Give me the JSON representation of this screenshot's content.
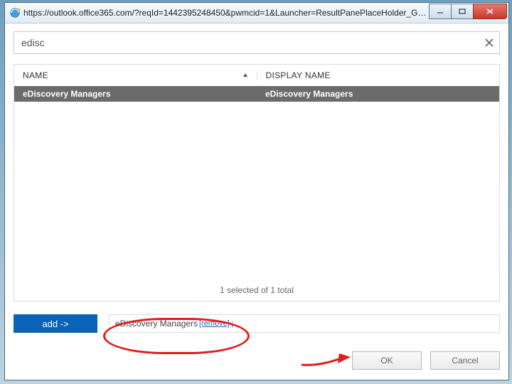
{
  "titlebar": {
    "url": "https://outlook.office365.com/?reqId=1442395248450&pwmcid=1&Launcher=ResultPanePlaceHolder_Gro..."
  },
  "search": {
    "value": "edisc"
  },
  "columns": {
    "name_header": "NAME",
    "display_header": "DISPLAY NAME"
  },
  "rows": [
    {
      "name": "eDiscovery Managers",
      "display": "eDiscovery Managers"
    }
  ],
  "status": "1 selected of 1 total",
  "add": {
    "button": "add ->",
    "token_name": "eDiscovery Managers",
    "remove_label": "[remove]",
    "sep": ";"
  },
  "footer": {
    "ok": "OK",
    "cancel": "Cancel"
  }
}
